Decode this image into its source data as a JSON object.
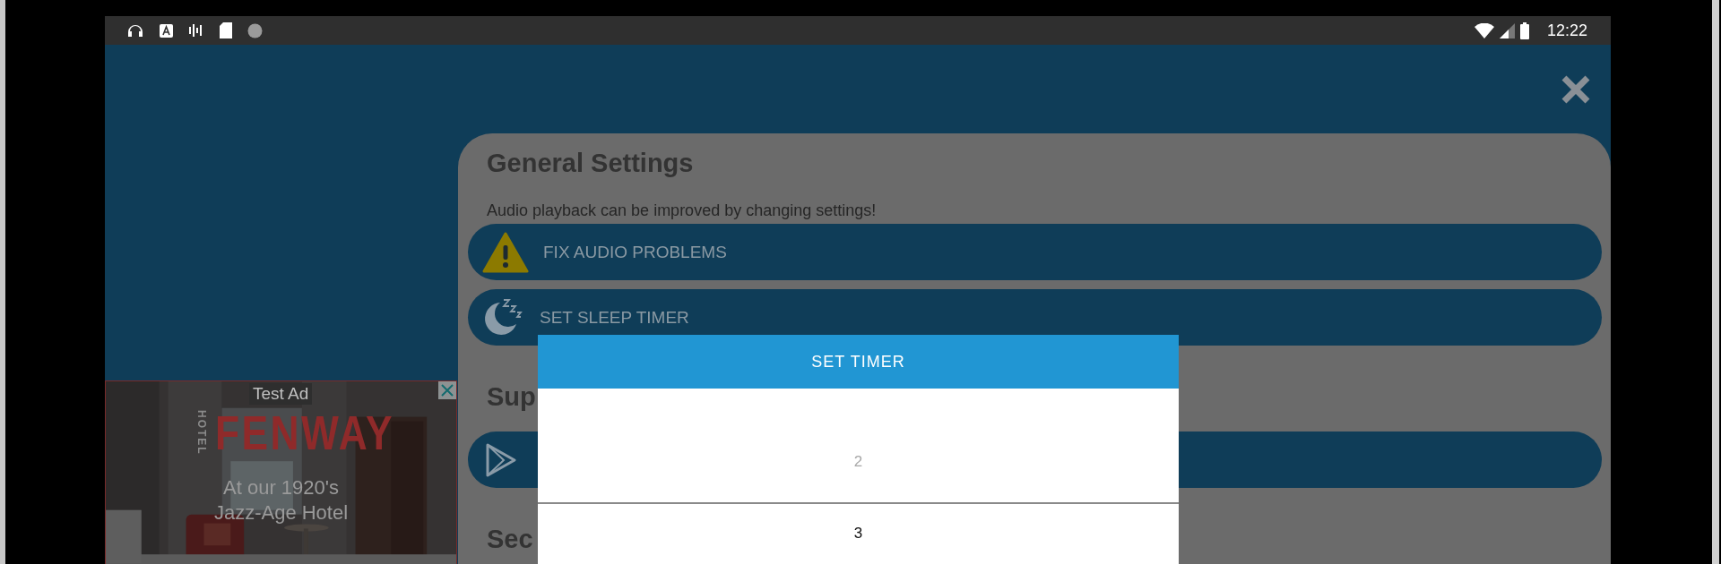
{
  "status_bar": {
    "time": "12:22"
  },
  "sections": [
    {
      "title": "General Settings",
      "subtitle": "Audio playback can be improved by changing settings!",
      "buttons": [
        {
          "label": "FIX AUDIO PROBLEMS",
          "kind": "warning"
        },
        {
          "label": "SET SLEEP TIMER",
          "kind": "sleep"
        }
      ]
    },
    {
      "title": "Sup",
      "buttons": [
        {
          "kind": "play"
        }
      ]
    },
    {
      "title": "Sec"
    }
  ],
  "ad": {
    "badge": "Test Ad",
    "brand_prefix": "HOTEL",
    "brand": "FENWAY",
    "lines": [
      "At our 1920's",
      "Jazz-Age Hotel"
    ]
  },
  "dialog": {
    "title": "SET TIMER",
    "items": [
      {
        "label": "2",
        "selected": false
      },
      {
        "label": "3",
        "selected": true
      }
    ]
  }
}
